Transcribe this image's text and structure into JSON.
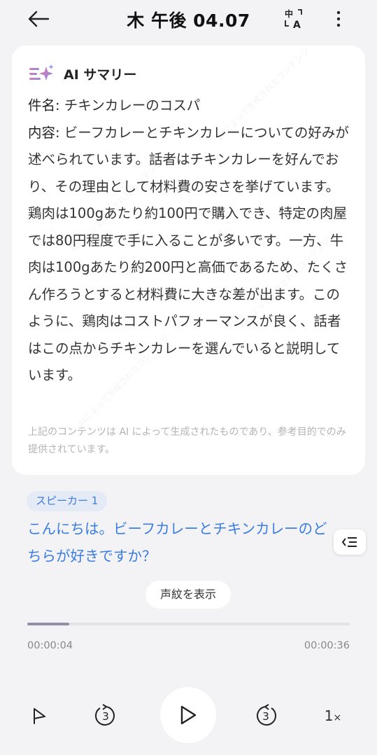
{
  "header": {
    "title": "木 午後 04.07",
    "back_icon": "arrow-left-icon",
    "translate_icon": "translate-icon",
    "more_icon": "more-vertical-icon"
  },
  "summary": {
    "heading": "AI サマリー",
    "subject_label": "件名:",
    "subject": " チキンカレーのコスパ",
    "content_label": "内容:",
    "content": " ビーフカレーとチキンカレーについての好みが述べられています。話者はチキンカレーを好んでおり、その理由として材料費の安さを挙げています。鶏肉は100gあたり約100円で購入でき、特定の肉屋では80円程度で手に入ることが多いです。一方、牛肉は100gあたり約200円と高価であるため、たくさん作ろうとすると材料費に大きな差が出ます。このように、鶏肉はコストパフォーマンスが良く、話者はこの点からチキンカレーを選んでいると説明しています。",
    "disclaimer": "上記のコンテンツは AI によって生成されたものであり、参考目的でのみ提供されています。",
    "watermark": "AIによって生成されたコンテンツ"
  },
  "transcript": {
    "speaker": "スピーカー 1",
    "text": "こんにちは。ビーフカレーとチキンカレーのどちらが好きですか？"
  },
  "voiceprint_button": "声紋を表示",
  "player": {
    "current_time": "00:00:04",
    "total_time": "00:00:36",
    "progress": 0.13,
    "speed": "1",
    "speed_suffix": "×"
  },
  "colors": {
    "accent": "#3b7de3",
    "background": "#f3f3f5",
    "card": "#ffffff"
  }
}
